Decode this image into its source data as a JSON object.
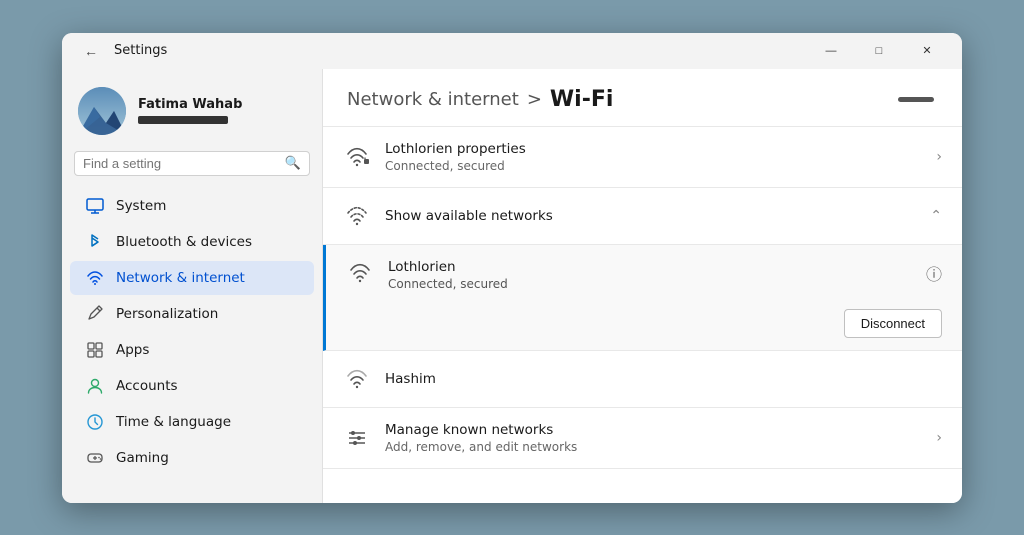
{
  "window": {
    "title": "Settings",
    "controls": {
      "minimize": "—",
      "maximize": "□",
      "close": "✕"
    }
  },
  "user": {
    "name": "Fatima Wahab",
    "email_placeholder": "••••••••••••••"
  },
  "search": {
    "placeholder": "Find a setting"
  },
  "nav": {
    "items": [
      {
        "id": "system",
        "label": "System",
        "icon": "monitor"
      },
      {
        "id": "bluetooth",
        "label": "Bluetooth & devices",
        "icon": "bluetooth"
      },
      {
        "id": "network",
        "label": "Network & internet",
        "icon": "network",
        "active": true
      },
      {
        "id": "personalization",
        "label": "Personalization",
        "icon": "pencil"
      },
      {
        "id": "apps",
        "label": "Apps",
        "icon": "grid"
      },
      {
        "id": "accounts",
        "label": "Accounts",
        "icon": "person"
      },
      {
        "id": "time",
        "label": "Time & language",
        "icon": "globe"
      },
      {
        "id": "gaming",
        "label": "Gaming",
        "icon": "game"
      }
    ]
  },
  "page": {
    "parent": "Network & internet",
    "separator": ">",
    "current": "Wi-Fi"
  },
  "content": {
    "connected_network": {
      "name": "Lothlorien properties",
      "status": "Connected, secured"
    },
    "available_networks_label": "Show available networks",
    "expanded_network": {
      "name": "Lothlorien",
      "status": "Connected, secured",
      "disconnect_label": "Disconnect"
    },
    "other_network": {
      "name": "Hashim"
    },
    "manage_networks": {
      "title": "Manage known networks",
      "subtitle": "Add, remove, and edit networks"
    }
  }
}
